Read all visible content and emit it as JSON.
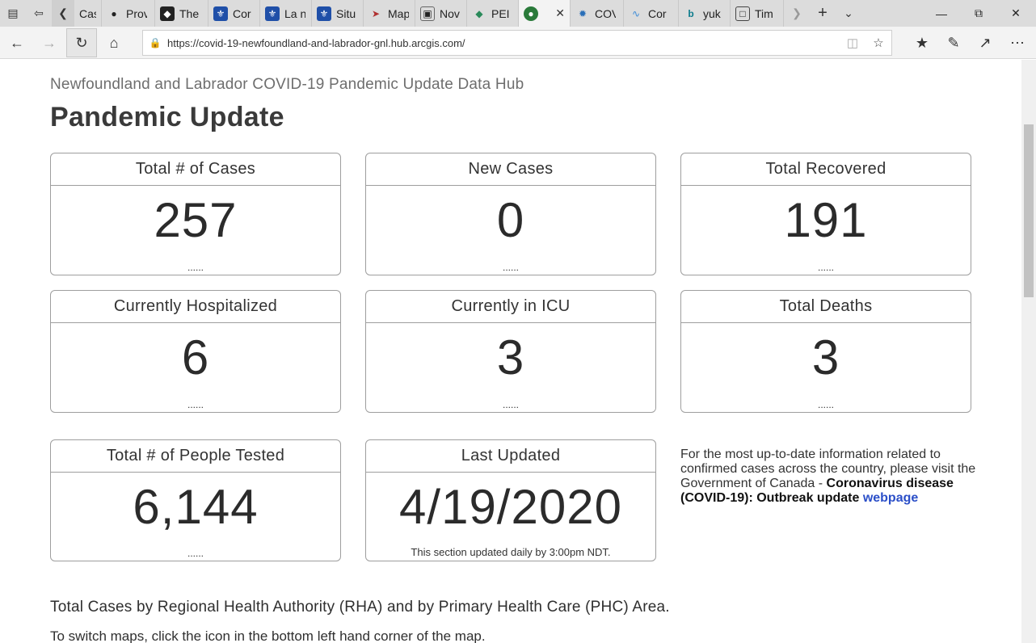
{
  "browser": {
    "tabs": [
      {
        "label": "Case",
        "icon": "page-icon",
        "color": "#888888"
      },
      {
        "label": "Prov",
        "icon": "bison-icon",
        "color": "#555555"
      },
      {
        "label": "The",
        "icon": "shield-icon",
        "color": "#222222"
      },
      {
        "label": "Cor",
        "icon": "fleur-de-lis-icon",
        "color": "#1f4fa8"
      },
      {
        "label": "La n",
        "icon": "fleur-de-lis-icon",
        "color": "#1f4fa8"
      },
      {
        "label": "Situ",
        "icon": "fleur-de-lis-icon",
        "color": "#1f4fa8"
      },
      {
        "label": "Map",
        "icon": "map-pin-icon",
        "color": "#b03030"
      },
      {
        "label": "Nov",
        "icon": "image-icon",
        "color": "#666666"
      },
      {
        "label": "PEI C",
        "icon": "pei-icon",
        "color": "#2a8a5a"
      },
      {
        "label": "",
        "icon": "globe-icon",
        "color": "#2a7a3a",
        "active": true
      },
      {
        "label": "COV",
        "icon": "covid-icon",
        "color": "#2a6fb8"
      },
      {
        "label": "Cor",
        "icon": "wave-icon",
        "color": "#3a8ad8"
      },
      {
        "label": "yuk",
        "icon": "bing-icon",
        "color": "#0c7b8c"
      },
      {
        "label": "Tim",
        "icon": "page-icon",
        "color": "#444444"
      }
    ],
    "url": "https://covid-19-newfoundland-and-labrador-gnl.hub.arcgis.com/"
  },
  "page": {
    "hub_title": "Newfoundland and Labrador COVID-19 Pandemic Update Data Hub",
    "title": "Pandemic Update",
    "cards": [
      {
        "heading": "Total # of Cases",
        "value": "257",
        "footer": "......"
      },
      {
        "heading": "New Cases",
        "value": "0",
        "footer": "......"
      },
      {
        "heading": "Total Recovered",
        "value": "191",
        "footer": "......"
      },
      {
        "heading": "Currently Hospitalized",
        "value": "6",
        "footer": "......"
      },
      {
        "heading": "Currently in ICU",
        "value": "3",
        "footer": "......"
      },
      {
        "heading": "Total Deaths",
        "value": "3",
        "footer": "......"
      },
      {
        "heading": "Total # of People Tested",
        "value": "6,144",
        "footer": "......"
      },
      {
        "heading": "Last Updated",
        "value": "4/19/2020",
        "footer": "This section updated daily by 3:00pm NDT."
      }
    ],
    "info": {
      "text": "For the most up-to-date information related to confirmed cases across the country, please visit the Government of Canada - ",
      "bold": "Coronavirus disease (COVID-19): Outbreak update",
      "link": "webpage"
    },
    "section_heading": "Total Cases by Regional Health Authority (RHA) and by Primary Health Care (PHC) Area.",
    "section_instructions": "To switch maps, click the icon in the bottom left hand corner of the map."
  }
}
